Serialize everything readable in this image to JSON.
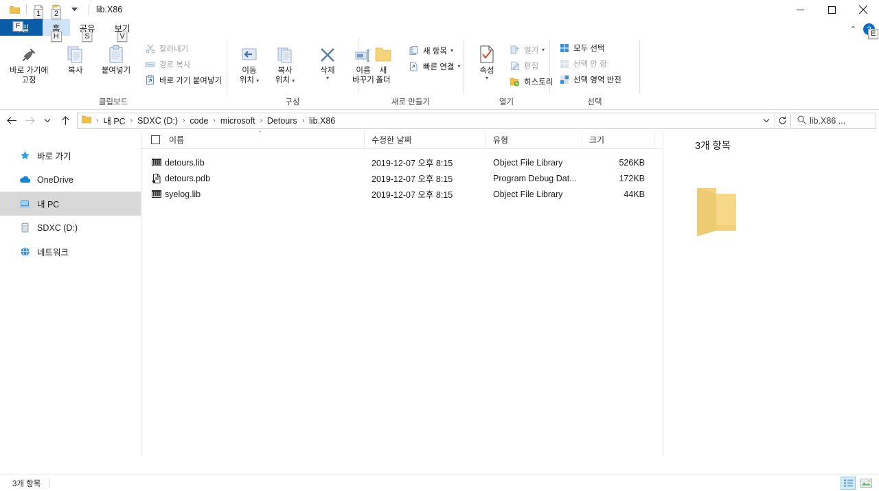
{
  "window": {
    "title": "lib.X86",
    "quick_access": [
      {
        "name": "folder-icon",
        "keytip": ""
      },
      {
        "name": "properties-icon",
        "keytip": "1"
      },
      {
        "name": "new-folder-icon",
        "keytip": "2"
      },
      {
        "name": "customize-caret-icon",
        "keytip": ""
      }
    ],
    "controls": {
      "minimize": "─",
      "maximize": "□",
      "close": "✕"
    }
  },
  "tabs": [
    {
      "label": "파일",
      "keytip": "F",
      "style": "file"
    },
    {
      "label": "홈",
      "keytip": "H",
      "style": "active"
    },
    {
      "label": "공유",
      "keytip": "S",
      "style": "normal"
    },
    {
      "label": "보기",
      "keytip": "V",
      "style": "normal"
    }
  ],
  "ribbon_controls": {
    "collapse_caret": "⌃",
    "help_label": "?",
    "help_keytip": "E"
  },
  "ribbon": {
    "groups": [
      {
        "title": "클립보드",
        "big_buttons": [
          {
            "label_line1": "바로 가기에",
            "label_line2": "고정",
            "icon": "pin-icon"
          },
          {
            "label_line1": "복사",
            "label_line2": "",
            "icon": "copy-icon"
          },
          {
            "label_line1": "붙여넣기",
            "label_line2": "",
            "icon": "paste-icon"
          }
        ],
        "small_buttons": [
          {
            "label": "잘라내기",
            "icon": "scissors-icon",
            "dim": true
          },
          {
            "label": "경로 복사",
            "icon": "copy-path-icon",
            "dim": true
          },
          {
            "label": "바로 가기 붙여넣기",
            "icon": "paste-shortcut-icon",
            "dim": false
          }
        ]
      },
      {
        "title": "구성",
        "big_buttons": [
          {
            "label_line1": "이동",
            "label_line2": "위치",
            "icon": "move-to-icon",
            "caret": true
          },
          {
            "label_line1": "복사",
            "label_line2": "위치",
            "icon": "copy-to-icon",
            "caret": true
          },
          {
            "label_line1": "삭제",
            "label_line2": "",
            "icon": "delete-icon",
            "caret": true
          },
          {
            "label_line1": "이름",
            "label_line2": "바꾸기",
            "icon": "rename-icon"
          }
        ],
        "small_buttons": []
      },
      {
        "title": "새로 만들기",
        "big_buttons": [
          {
            "label_line1": "새",
            "label_line2": "폴더",
            "icon": "new-folder-icon"
          }
        ],
        "small_buttons": [
          {
            "label": "새 항목",
            "icon": "new-item-icon",
            "dim": false,
            "caret": true
          },
          {
            "label": "빠른 연결",
            "icon": "easy-access-icon",
            "dim": false,
            "caret": true
          }
        ]
      },
      {
        "title": "열기",
        "big_buttons": [
          {
            "label_line1": "속성",
            "label_line2": "",
            "icon": "properties-icon",
            "caret": true
          }
        ],
        "small_buttons": [
          {
            "label": "열기",
            "icon": "open-icon",
            "dim": true,
            "caret": true
          },
          {
            "label": "편집",
            "icon": "edit-icon",
            "dim": true
          },
          {
            "label": "히스토리",
            "icon": "history-icon",
            "dim": false
          }
        ]
      },
      {
        "title": "선택",
        "big_buttons": [],
        "small_buttons": [
          {
            "label": "모두 선택",
            "icon": "select-all-icon",
            "dim": false
          },
          {
            "label": "선택 안 함",
            "icon": "select-none-icon",
            "dim": true
          },
          {
            "label": "선택 영역 반전",
            "icon": "invert-selection-icon",
            "dim": false
          }
        ]
      }
    ]
  },
  "addressbar": {
    "back": "←",
    "forward": "→",
    "recent": "⌄",
    "up": "↑",
    "breadcrumbs": [
      "내 PC",
      "SDXC (D:)",
      "code",
      "microsoft",
      "Detours",
      "lib.X86"
    ],
    "separator": "›",
    "dropdown": "⌄",
    "refresh": "↻",
    "search_placeholder": "lib.X86 ..."
  },
  "navpane": {
    "items": [
      {
        "label": "바로 가기",
        "icon": "star-icon",
        "selected": false
      },
      {
        "label": "OneDrive",
        "icon": "cloud-icon",
        "selected": false
      },
      {
        "label": "내 PC",
        "icon": "pc-icon",
        "selected": true
      },
      {
        "label": "SDXC (D:)",
        "icon": "drive-icon",
        "selected": false
      },
      {
        "label": "네트워크",
        "icon": "network-icon",
        "selected": false
      }
    ]
  },
  "filelist": {
    "columns": [
      "이름",
      "수정한 날짜",
      "유형",
      "크기"
    ],
    "sort_indicator": "⌃",
    "rows": [
      {
        "name": "detours.lib",
        "date": "2019-12-07 오후 8:15",
        "type": "Object File Library",
        "size": "526KB",
        "icon": "lib-file-icon"
      },
      {
        "name": "detours.pdb",
        "date": "2019-12-07 오후 8:15",
        "type": "Program Debug Dat...",
        "size": "172KB",
        "icon": "pdb-file-icon"
      },
      {
        "name": "syelog.lib",
        "date": "2019-12-07 오후 8:15",
        "type": "Object File Library",
        "size": "44KB",
        "icon": "lib-file-icon"
      }
    ]
  },
  "detailpane": {
    "title": "3개 항목",
    "icon": "open-folder-icon"
  },
  "statusbar": {
    "item_count": "3개 항목",
    "views": [
      {
        "name": "details-view",
        "active": true
      },
      {
        "name": "large-icons-view",
        "active": false
      }
    ]
  },
  "colors": {
    "file_tab": "#0a5ca8",
    "active_tab": "#cfe4f7",
    "selection": "#d8d8d8",
    "folder_yellow": "#f5d379",
    "accent_blue": "#0a6cc4"
  }
}
